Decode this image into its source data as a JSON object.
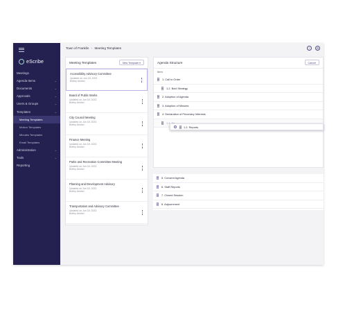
{
  "sidebar": {
    "logo": "eScribe",
    "items": [
      {
        "label": "Meetings",
        "chevron": false,
        "sub": false,
        "active": false
      },
      {
        "label": "Agenda Items",
        "chevron": true,
        "sub": false,
        "active": false
      },
      {
        "label": "Documents",
        "chevron": true,
        "sub": false,
        "active": false
      },
      {
        "label": "Approvals",
        "chevron": true,
        "sub": false,
        "active": false
      },
      {
        "label": "Users & Groups",
        "chevron": true,
        "sub": false,
        "active": false
      },
      {
        "label": "Templates",
        "chevron": true,
        "sub": false,
        "active": false
      },
      {
        "label": "Meeting Templates",
        "chevron": false,
        "sub": true,
        "active": true
      },
      {
        "label": "Motion Templates",
        "chevron": false,
        "sub": true,
        "active": false
      },
      {
        "label": "Minutes Templates",
        "chevron": false,
        "sub": true,
        "active": false
      },
      {
        "label": "Email Templates",
        "chevron": false,
        "sub": true,
        "active": false
      },
      {
        "label": "Administration",
        "chevron": true,
        "sub": false,
        "active": false
      },
      {
        "label": "Tools",
        "chevron": true,
        "sub": false,
        "active": false
      },
      {
        "label": "Reporting",
        "chevron": false,
        "sub": false,
        "active": false
      }
    ]
  },
  "breadcrumb": {
    "root": "Town of Franklin",
    "separator": "›",
    "current": "Meeting Templates"
  },
  "header_icons": [
    "help-icon",
    "settings-icon"
  ],
  "templates_panel": {
    "title": "Meeting Templates",
    "new_button": "New Template ▾",
    "items": [
      {
        "name": "Accessibility Advisory Committee",
        "updated": "Updated on Jun 18, 2023",
        "author": "Bobby Ashton"
      },
      {
        "name": "Board of Public Works",
        "updated": "Updated on Jun 18, 2023",
        "author": "Bobby Ashton"
      },
      {
        "name": "City Council Meeting",
        "updated": "Updated on Jun 18, 2023",
        "author": "Bobby Ashton"
      },
      {
        "name": "Finance Meeting",
        "updated": "Updated on Jun 18, 2023",
        "author": "Bobby Ashton"
      },
      {
        "name": "Parks and Recreation Committee Meeting",
        "updated": "Updated on Jun 18, 2023",
        "author": "Bobby Ashton"
      },
      {
        "name": "Planning and Development Advisory",
        "updated": "Updated on Jun 18, 2023",
        "author": "Bobby Ashton"
      },
      {
        "name": "Transportation and Advisory Committee",
        "updated": "Updated on Jun 18, 2023",
        "author": "Bobby Ashton"
      }
    ]
  },
  "agenda_panel": {
    "title": "Agenda Structure",
    "cancel_button": "Cancel",
    "column_header": "Item",
    "items_top": [
      {
        "label": "1. Call to Order",
        "child": false,
        "ghost": false
      },
      {
        "label": "1.2. Bold Strategy",
        "child": true,
        "ghost": false
      },
      {
        "label": "2. Adoption of Agenda",
        "child": false,
        "ghost": false
      },
      {
        "label": "3. Adoption of Minutes",
        "child": false,
        "ghost": false
      },
      {
        "label": "4. Declaration of Pecuniary Interests",
        "child": false,
        "ghost": false
      },
      {
        "label": "1.1. Ag...",
        "child": true,
        "ghost": true
      }
    ],
    "dragging_item": "1.2. Reports",
    "items_bottom": [
      {
        "label": "5. Consent Agenda"
      },
      {
        "label": "6. Staff Reports"
      },
      {
        "label": "7. Closed Session"
      },
      {
        "label": "8. Adjournment"
      }
    ]
  }
}
